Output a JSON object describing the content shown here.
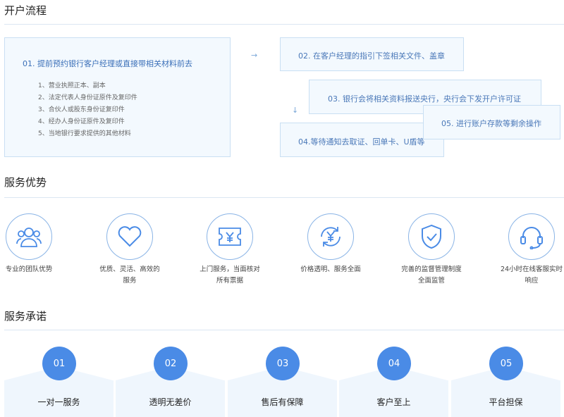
{
  "sections": {
    "process_title": "开户流程",
    "advantages_title": "服务优势",
    "commitment_title": "服务承诺"
  },
  "process": {
    "step1": "01. 提前预约银行客户经理或直接带相关材料前去",
    "step1_items": [
      "1、营业执照正本、副本",
      "2、法定代表人身份证原件及复印件",
      "3、合伙人或股东身份证复印件",
      "4、经办人身份证原件及复印件",
      "5、当地银行要求提供的其他材料"
    ],
    "step2": "02. 在客户经理的指引下签相关文件、盖章",
    "step3": "03. 银行会将相关资料报送央行，央行会下发开户许可证",
    "step4": "04.等待通知去取证、回单卡、U盾等",
    "step5": "05. 进行账户存款等剩余操作",
    "arrow_right": "→",
    "arrow_down": "↓"
  },
  "advantages": [
    {
      "icon": "team-icon",
      "label": "专业的团队优势"
    },
    {
      "icon": "heart-icon",
      "label": "优质、灵活、高效的服务"
    },
    {
      "icon": "ticket-icon",
      "label": "上门服务，当面核对所有票据"
    },
    {
      "icon": "price-cycle-icon",
      "label": "价格透明、服务全面"
    },
    {
      "icon": "shield-check-icon",
      "label": "完善的监督管理制度全面监管"
    },
    {
      "icon": "headset-icon",
      "label": "24小时在线客服实时响应"
    }
  ],
  "commitments": [
    {
      "num": "01",
      "name": "一对一服务"
    },
    {
      "num": "02",
      "name": "透明无差价"
    },
    {
      "num": "03",
      "name": "售后有保障"
    },
    {
      "num": "04",
      "name": "客户至上"
    },
    {
      "num": "05",
      "name": "平台担保"
    }
  ],
  "colors": {
    "accent": "#4a8be6",
    "border": "#c9dff3",
    "box_bg": "#f3f9fe"
  }
}
